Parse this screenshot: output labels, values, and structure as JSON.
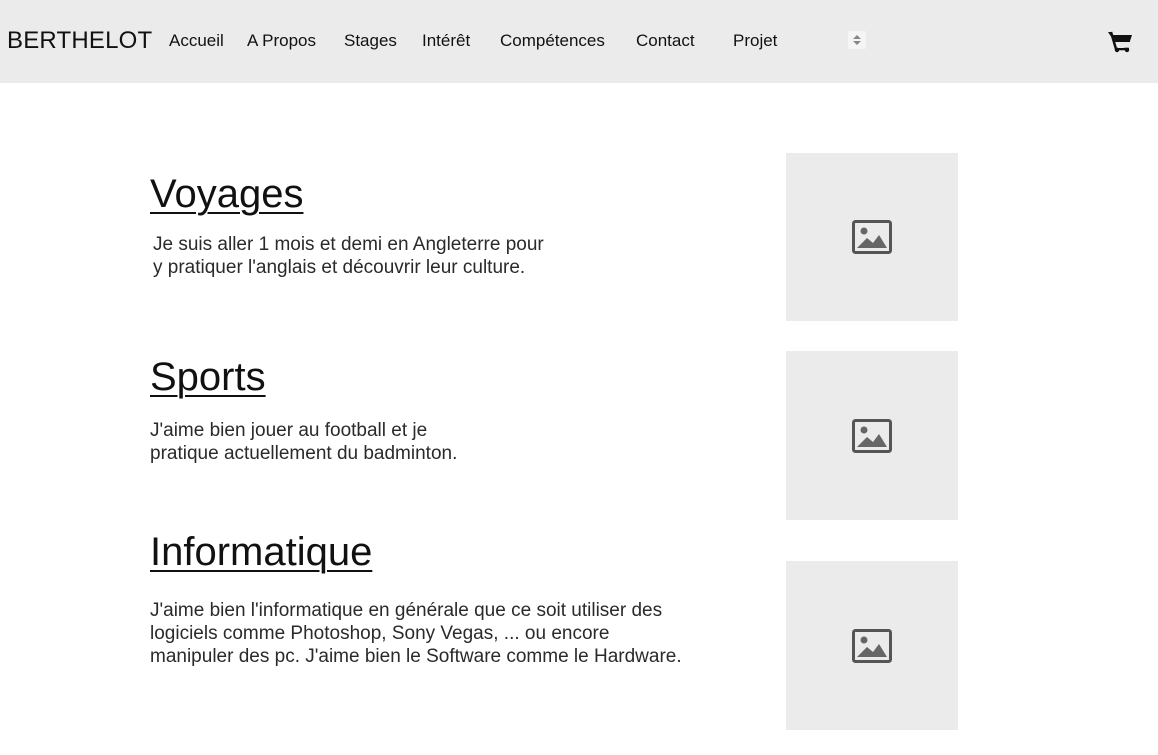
{
  "header": {
    "brand": "BERTHELOT",
    "nav": [
      {
        "label": "Accueil"
      },
      {
        "label": "A Propos"
      },
      {
        "label": "Stages"
      },
      {
        "label": "Intérêt"
      },
      {
        "label": "Compétences"
      },
      {
        "label": "Contact"
      },
      {
        "label": "Projet"
      }
    ],
    "more_icon": "up-down-arrows-icon",
    "cart_icon": "shopping-cart-icon"
  },
  "sections": [
    {
      "title": "Voyages",
      "lines": [
        "Je suis aller 1 mois et demi en Angleterre pour",
        "y pratiquer l'anglais et découvrir leur culture."
      ],
      "image_icon": "image-placeholder-icon"
    },
    {
      "title": "Sports",
      "lines": [
        "J'aime bien jouer au football et je",
        "pratique actuellement du badminton."
      ],
      "image_icon": "image-placeholder-icon"
    },
    {
      "title": "Informatique",
      "lines": [
        "J'aime bien l'informatique en générale que ce soit utiliser des",
        "logiciels comme Photoshop, Sony Vegas, ... ou encore",
        "manipuler des pc. J'aime bien le Software comme le Hardware."
      ],
      "image_icon": "image-placeholder-icon"
    }
  ]
}
